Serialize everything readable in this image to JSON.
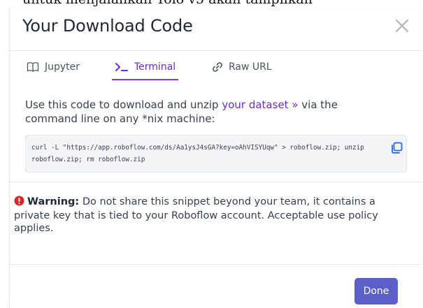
{
  "background": {
    "text": "untuk menjalankan Yolo v5 akan tampilkan"
  },
  "modal": {
    "title": "Your Download Code",
    "tabs": [
      {
        "label": "Jupyter",
        "icon": "book-icon"
      },
      {
        "label": "Terminal",
        "icon": "terminal-icon",
        "active": true
      },
      {
        "label": "Raw URL",
        "icon": "link-icon"
      }
    ],
    "description": {
      "prefix": "Use this code to download and unzip ",
      "link": "your dataset",
      "link_arrow": "»",
      "suffix": " via the command line on any *nix machine:"
    },
    "code": "curl -L \"https://app.roboflow.com/ds/Aa1ysJ4sGA?key=oAhVISYUqw\" > roboflow.zip; unzip roboflow.zip; rm roboflow.zip",
    "warning": {
      "label": "Warning:",
      "text": " Do not share this snippet beyond your team, it contains a private key that is tied to your Roboflow account. Acceptable use policy applies."
    },
    "done_label": "Done"
  },
  "colors": {
    "accent": "#6d28d9",
    "button": "#5b5fc7",
    "warning_icon": "#dc2626"
  }
}
